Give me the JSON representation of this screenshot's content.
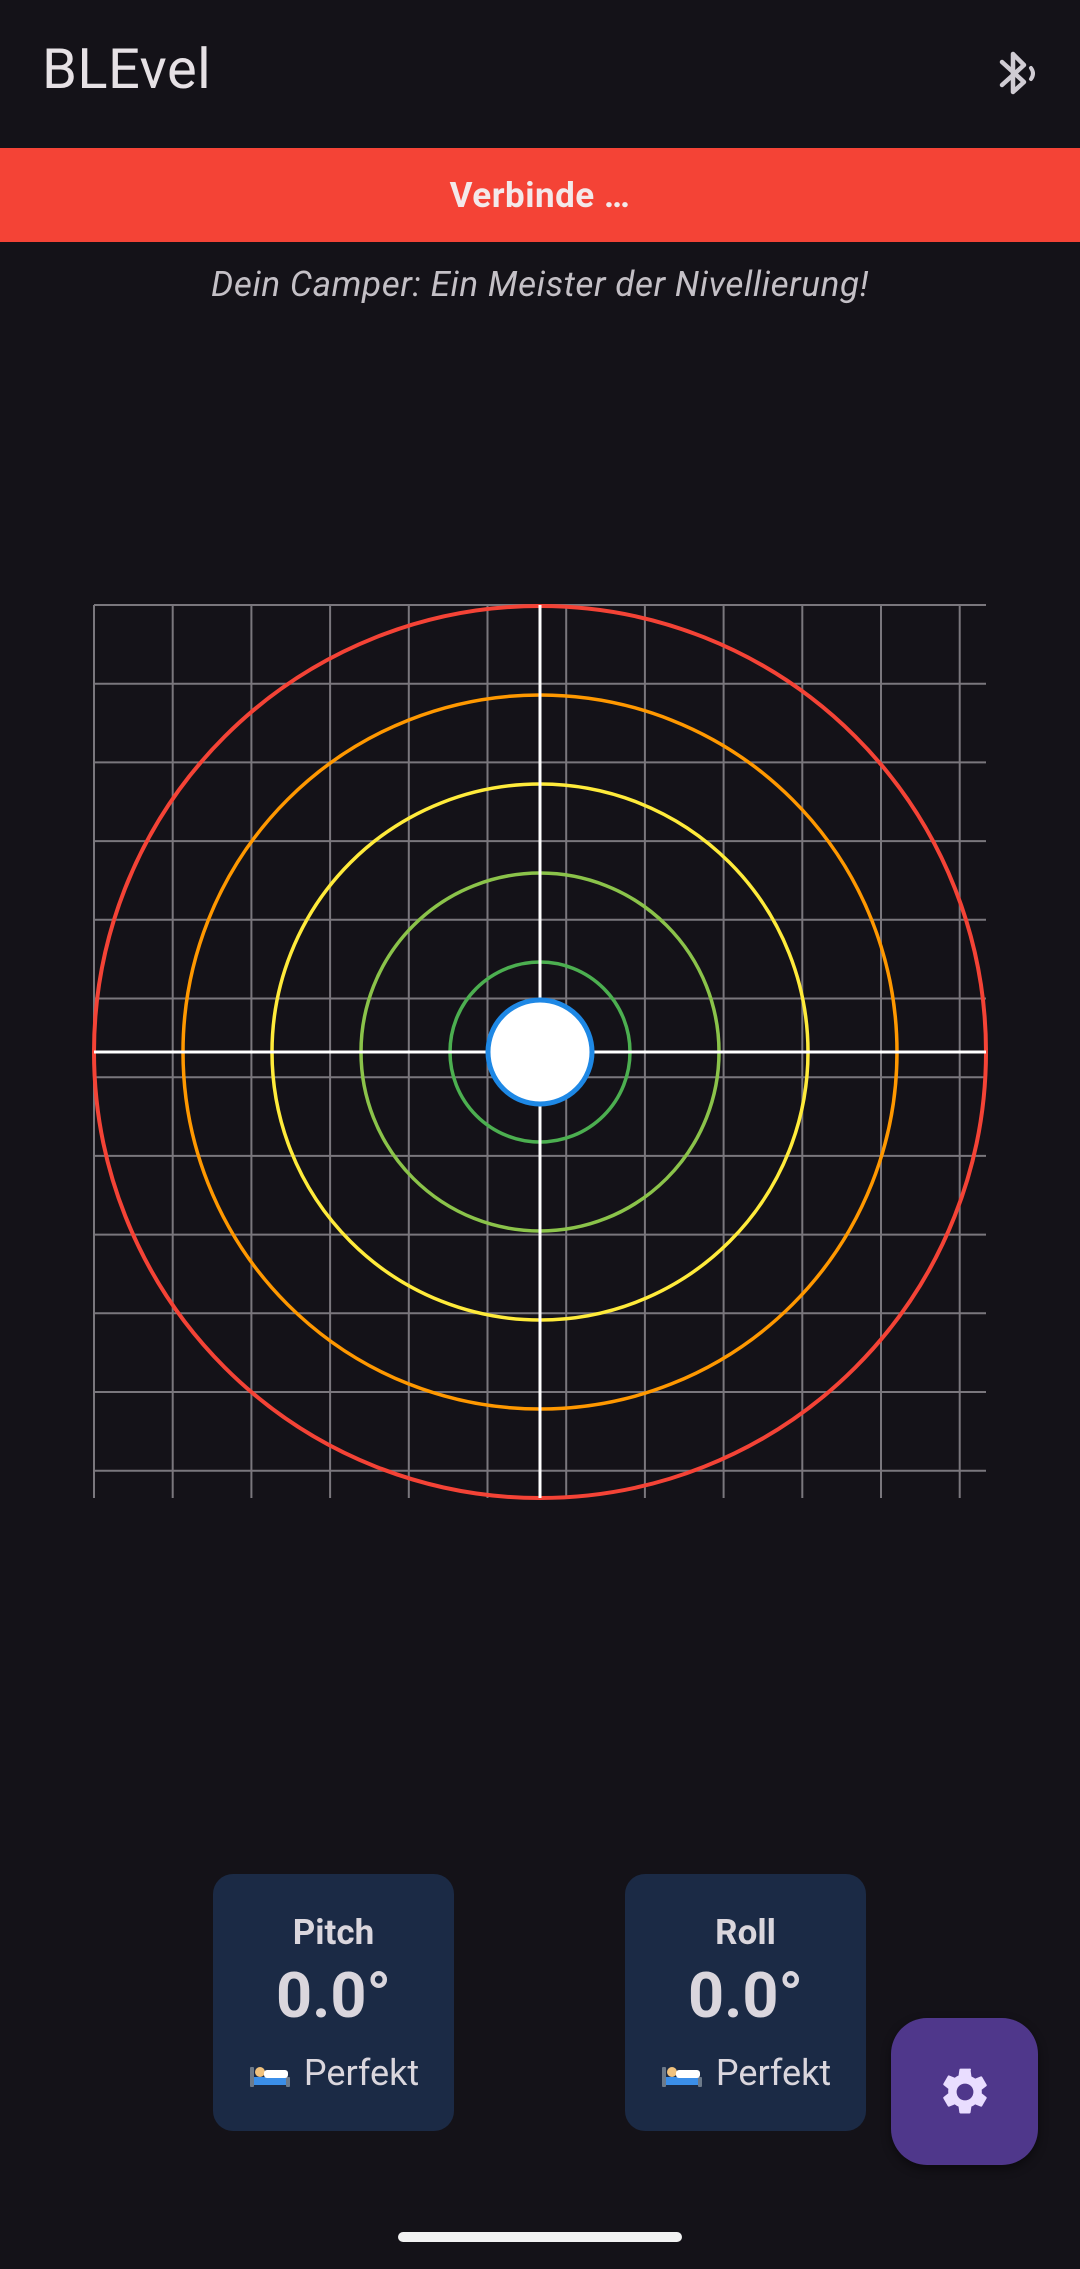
{
  "app": {
    "title": "BLEvel",
    "bluetooth_icon": "bluetooth-searching-icon"
  },
  "banner": {
    "text": "Verbinde …",
    "color": "#f44336"
  },
  "subtitle": "Dein Camper: Ein Meister der Nivellierung!",
  "level": {
    "pitch_deg": 0.0,
    "roll_deg": 0.0,
    "ring_colors": [
      "#f44336",
      "#ff9800",
      "#ffeb3b",
      "#8bc34a",
      "#4caf50"
    ],
    "bubble_fill": "#ffffff",
    "bubble_border": "#1e88e5",
    "grid_color": "#7a777d",
    "crosshair_color": "#ffffff"
  },
  "cards": {
    "pitch": {
      "label": "Pitch",
      "value": "0.0°",
      "status": "Perfekt",
      "status_icon": "bed-icon"
    },
    "roll": {
      "label": "Roll",
      "value": "0.0°",
      "status": "Perfekt",
      "status_icon": "bed-icon"
    }
  },
  "fab": {
    "icon": "gear-icon",
    "color": "#4f378b"
  }
}
